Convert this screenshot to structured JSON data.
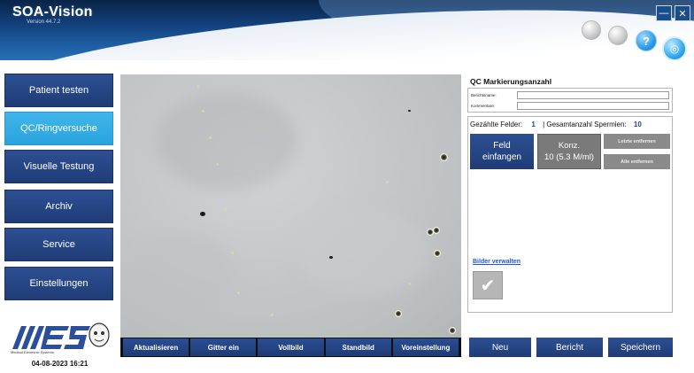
{
  "header": {
    "app_title": "SOA-Vision",
    "version": "Version 44.7.2",
    "help_icon_glyph": "?",
    "network_icon_glyph": "◎",
    "minimize_glyph": "—",
    "close_glyph": "✕"
  },
  "sidebar": {
    "items": [
      {
        "label": "Patient testen",
        "active": false
      },
      {
        "label": "QC/Ringversuche",
        "active": true
      },
      {
        "label": "Visuelle Testung",
        "active": false
      },
      {
        "label": "Archiv",
        "active": false
      },
      {
        "label": "Service",
        "active": false
      },
      {
        "label": "Einstellungen",
        "active": false
      }
    ],
    "logo_text": "MES",
    "datetime": "04-08-2023 16:21"
  },
  "toolbar": {
    "buttons": [
      "Aktualisieren",
      "Gitter ein",
      "Vollbild",
      "Standbild",
      "Voreinstellung"
    ]
  },
  "qc_panel": {
    "title": "QC Markierungsanzahl",
    "report_name_label": "Berichtsname:",
    "report_name_value": "",
    "comment_label": "Kommentare:",
    "comment_value": "",
    "counted_fields_label": "Gezählte Felder:",
    "counted_fields_value": "1",
    "total_sperm_label": "| Gesamtanzahl Spermien:",
    "total_sperm_value": "10",
    "capture_button_line1": "Feld",
    "capture_button_line2": "einfangen",
    "conc_button_line1": "Konz.",
    "conc_button_line2": "10 (5.3 M/ml)",
    "remove_last_label": "Letzte entfernen",
    "remove_all_label": "Alle entfernen",
    "manage_images_link": "Bilder verwalten",
    "thumb_glyph": "✔"
  },
  "actions": {
    "new_label": "Neu",
    "report_label": "Bericht",
    "save_label": "Speichern"
  },
  "colors": {
    "nav_blue": "#1f3c77",
    "nav_active": "#2aa3dd",
    "link_blue": "#2255cc"
  }
}
